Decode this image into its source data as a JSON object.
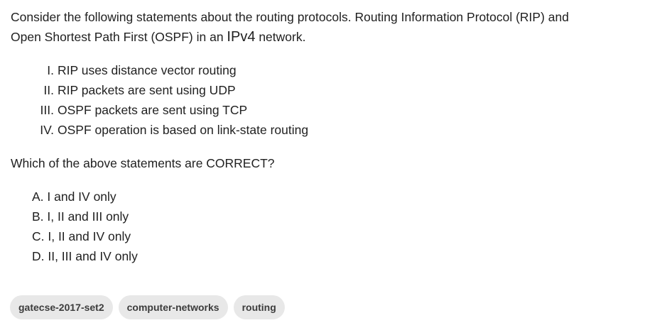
{
  "question": {
    "line1": "Consider the following statements about the routing protocols. Routing Information Protocol (RIP) and",
    "line2_prefix": "Open Shortest Path First (OSPF) in an ",
    "line2_ipv4": "IPv4",
    "line2_suffix": " network."
  },
  "statements": [
    {
      "num": "I.",
      "text": "RIP uses distance vector routing"
    },
    {
      "num": "II.",
      "text": "RIP packets are sent using UDP"
    },
    {
      "num": "III.",
      "text": "OSPF packets are sent using TCP"
    },
    {
      "num": "IV.",
      "text": "OSPF operation is based on link-state routing"
    }
  ],
  "prompt": "Which of the above statements are CORRECT?",
  "options": [
    "A. I and IV only",
    "B. I, II and III only",
    "C. I, II and IV only",
    "D. II, III and IV only"
  ],
  "tags": [
    "gatecse-2017-set2",
    "computer-networks",
    "routing"
  ]
}
